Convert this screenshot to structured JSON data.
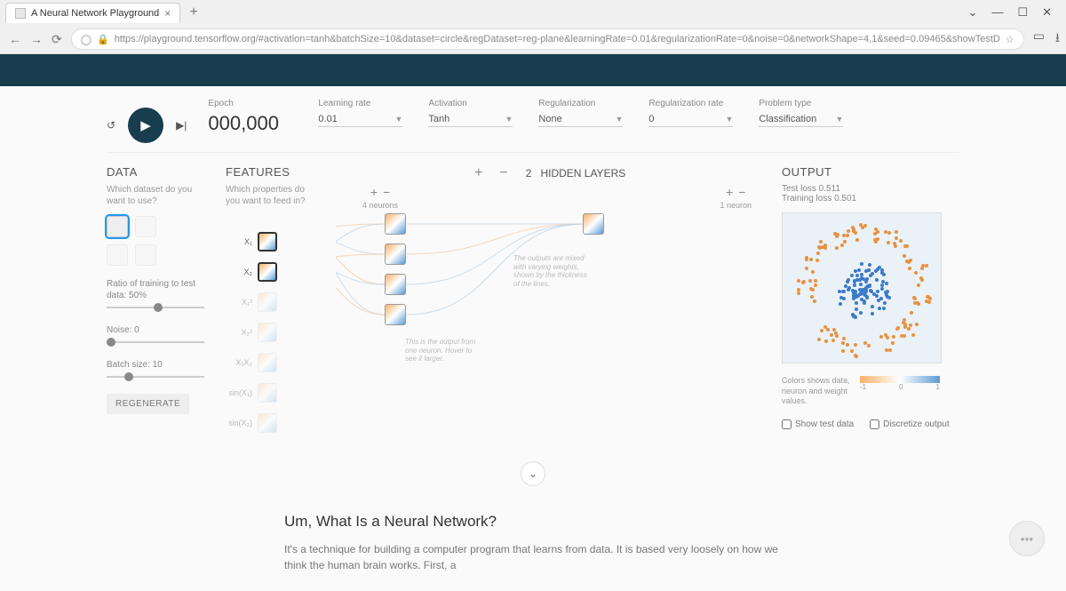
{
  "browser": {
    "tab_title": "A Neural Network Playground",
    "url": "https://playground.tensorflow.org/#activation=tanh&batchSize=10&dataset=circle&regDataset=reg-plane&learningRate=0.01&regularizationRate=0&noise=0&networkShape=4,1&seed=0.09465&showTestD"
  },
  "controls": {
    "epoch_label": "Epoch",
    "epoch_value": "000,000",
    "learning_rate_label": "Learning rate",
    "learning_rate_value": "0.01",
    "activation_label": "Activation",
    "activation_value": "Tanh",
    "regularization_label": "Regularization",
    "regularization_value": "None",
    "reg_rate_label": "Regularization rate",
    "reg_rate_value": "0",
    "problem_label": "Problem type",
    "problem_value": "Classification"
  },
  "data_panel": {
    "title": "DATA",
    "subtitle": "Which dataset do you want to use?",
    "ratio_label": "Ratio of training to test data:  50%",
    "noise_label": "Noise:  0",
    "batch_label": "Batch size:  10",
    "regenerate": "REGENERATE"
  },
  "features_panel": {
    "title": "FEATURES",
    "subtitle": "Which properties do you want to feed in?",
    "items": [
      "X₁",
      "X₂",
      "X₁²",
      "X₂²",
      "X₁X₂",
      "sin(X₁)",
      "sin(X₂)"
    ]
  },
  "network": {
    "hidden_layers_count": "2",
    "hidden_layers_label": "HIDDEN LAYERS",
    "layer1_neurons": "4 neurons",
    "layer2_neurons": "1 neuron",
    "hint1": "The outputs are mixed with varying weights, shown by the thickness of the lines.",
    "hint2": "This is the output from one neuron. Hover to see it larger."
  },
  "output": {
    "title": "OUTPUT",
    "test_loss": "Test loss 0.511",
    "train_loss": "Training loss 0.501",
    "legend_text": "Colors shows data, neuron and weight values.",
    "legend_ticks": [
      "-1",
      "0",
      "1"
    ],
    "show_test": "Show test data",
    "discretize": "Discretize output"
  },
  "article": {
    "heading": "Um, What Is a Neural Network?",
    "body": "It's a technique for building a computer program that learns from data. It is based very loosely on how we think the human brain works. First, a"
  }
}
